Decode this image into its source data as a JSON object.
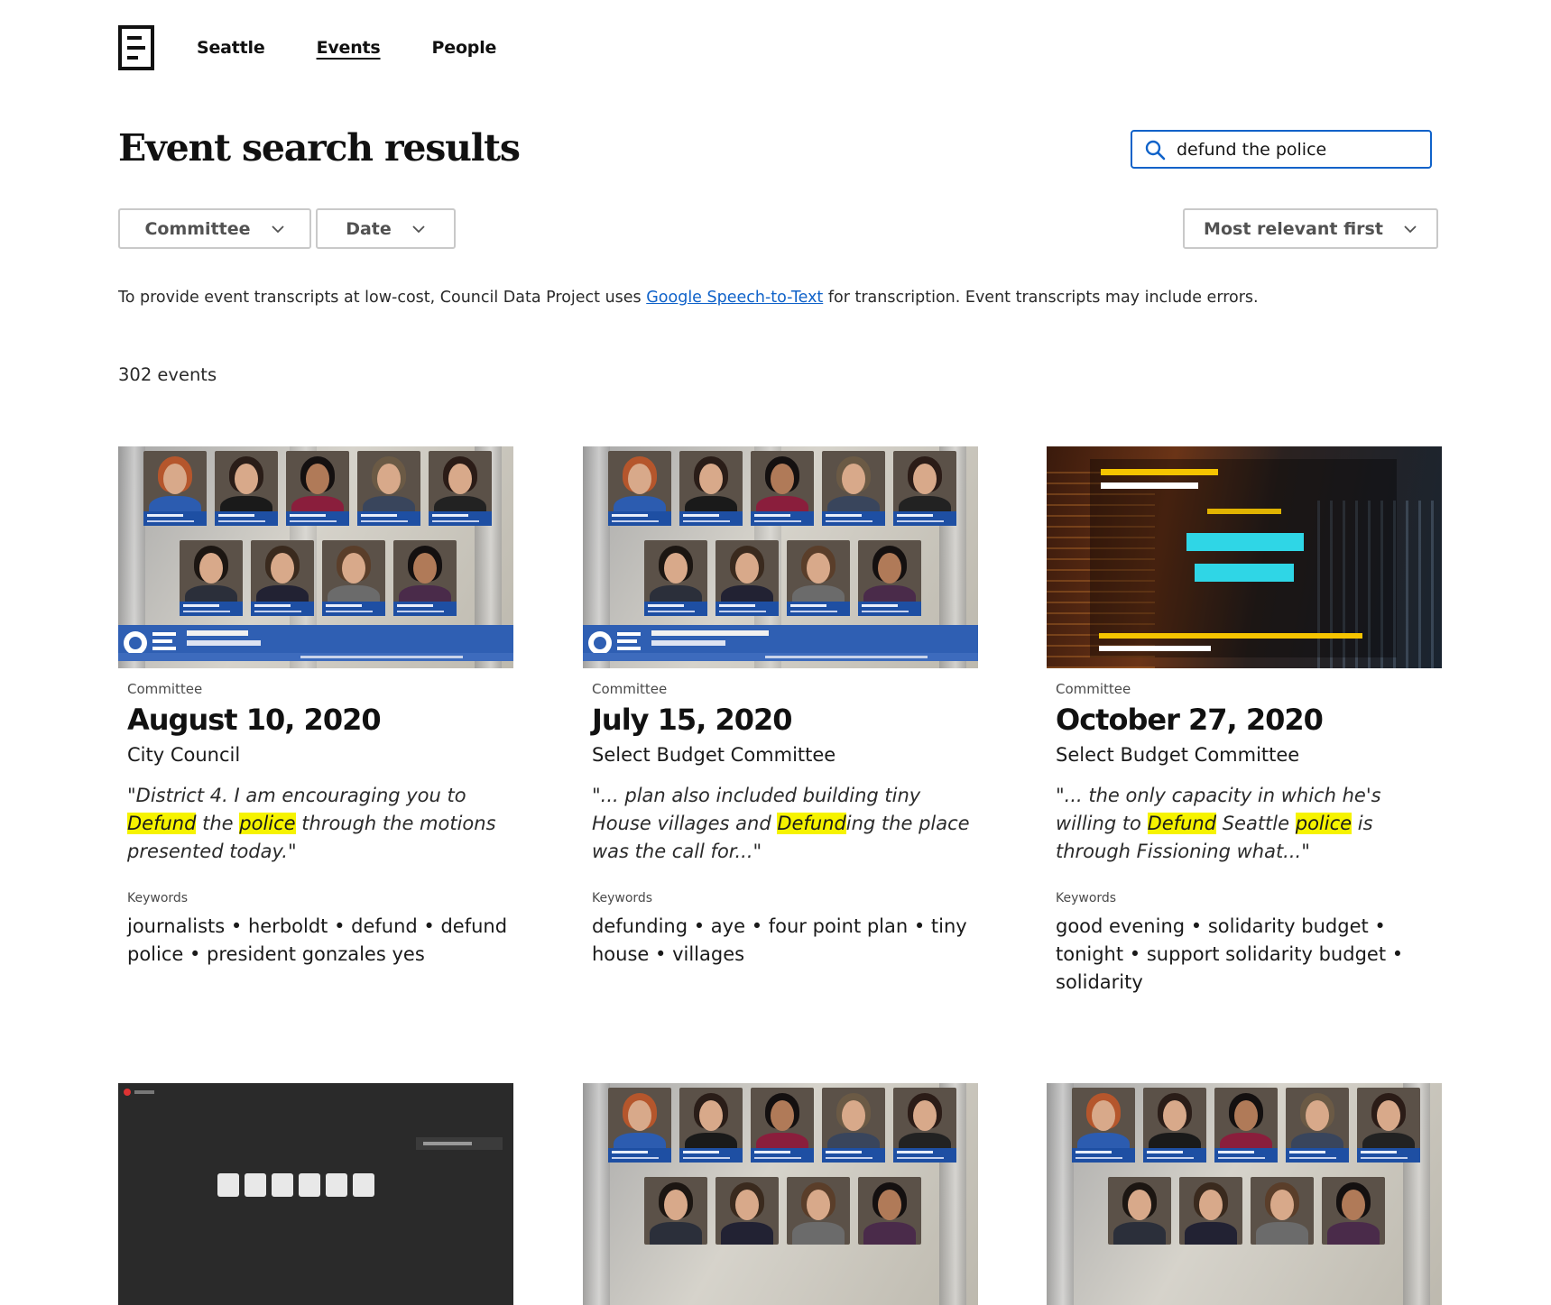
{
  "nav": {
    "logo_icon": "document-lines-logo-icon",
    "links": [
      {
        "label": "Seattle",
        "active": false
      },
      {
        "label": "Events",
        "active": true
      },
      {
        "label": "People",
        "active": false
      }
    ]
  },
  "header": {
    "title": "Event search results"
  },
  "search": {
    "value": "defund the police",
    "icon": "search-icon",
    "accent_color": "#0f62c9"
  },
  "filters": {
    "committee_label": "Committee",
    "date_label": "Date",
    "sort_label": "Most relevant first"
  },
  "notice": {
    "before": "To provide event transcripts at low-cost, Council Data Project uses ",
    "link_text": "Google Speech-to-Text",
    "after": " for transcription. Event transcripts may include errors."
  },
  "results": {
    "count_text": "302 events"
  },
  "highlight_color": "#f6f300",
  "cards": [
    {
      "type": "Committee",
      "date": "August 10, 2020",
      "committee": "City Council",
      "quote_parts": [
        {
          "text": "\"District 4. I am encouraging you to ",
          "hl": false
        },
        {
          "text": "Defund",
          "hl": true
        },
        {
          "text": " the ",
          "hl": false
        },
        {
          "text": "police",
          "hl": true
        },
        {
          "text": " through the motions presented today.\"",
          "hl": false
        }
      ],
      "keywords_label": "Keywords",
      "keywords": "journalists • herboldt • defund • defund police • president gonzales yes",
      "thumb": "council"
    },
    {
      "type": "Committee",
      "date": "July 15, 2020",
      "committee": "Select Budget Committee",
      "quote_parts": [
        {
          "text": "\"... plan also included building tiny House villages and ",
          "hl": false
        },
        {
          "text": "Defund",
          "hl": true
        },
        {
          "text": "ing the place was the call for...\"",
          "hl": false
        }
      ],
      "keywords_label": "Keywords",
      "keywords": "defunding • aye • four point plan • tiny house • villages",
      "thumb": "council"
    },
    {
      "type": "Committee",
      "date": "October 27, 2020",
      "committee": "Select Budget Committee",
      "quote_parts": [
        {
          "text": "\"... the only capacity in which he's willing to ",
          "hl": false
        },
        {
          "text": "Defund",
          "hl": true
        },
        {
          "text": " Seattle ",
          "hl": false
        },
        {
          "text": "police",
          "hl": true
        },
        {
          "text": " is through Fissioning what...\"",
          "hl": false
        }
      ],
      "keywords_label": "Keywords",
      "keywords": "good evening • solidarity budget • tonight • support solidarity budget • solidarity",
      "thumb": "channel"
    }
  ]
}
